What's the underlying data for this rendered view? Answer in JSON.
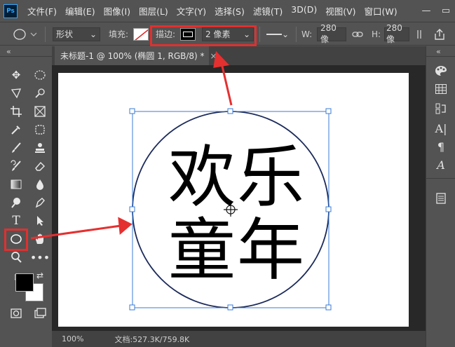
{
  "app": {
    "logo_text": "Ps"
  },
  "menu": [
    "文件(F)",
    "编辑(E)",
    "图像(I)",
    "图层(L)",
    "文字(Y)",
    "选择(S)",
    "滤镜(T)",
    "3D(D)",
    "视图(V)",
    "窗口(W)"
  ],
  "options": {
    "mode_value": "形状",
    "fill_label": "填充:",
    "stroke_label": "描边:",
    "stroke_width_value": "2 像素",
    "width_label": "W:",
    "width_value": "280 像",
    "height_label": "H:",
    "height_value": "280 像"
  },
  "document": {
    "tab_title": "未标题-1 @ 100% (椭圆 1, RGB/8) *",
    "close_glyph": "×",
    "canvas_text_line1": "欢乐",
    "canvas_text_line2": "童年"
  },
  "status": {
    "zoom": "100%",
    "doc_info": "文档:527.3K/759.8K"
  },
  "panel_collapse": "«",
  "colors": {
    "accent": "#e03030",
    "ellipse_stroke": "#1b2a5a",
    "selection": "#3a7bd5",
    "foreground": "#000000",
    "background": "#ffffff"
  },
  "icons": {
    "ellipse_tool": "ellipse-icon",
    "hand_tool": "hand-icon",
    "text_tool": "type-icon",
    "zoom_tool": "zoom-icon"
  }
}
